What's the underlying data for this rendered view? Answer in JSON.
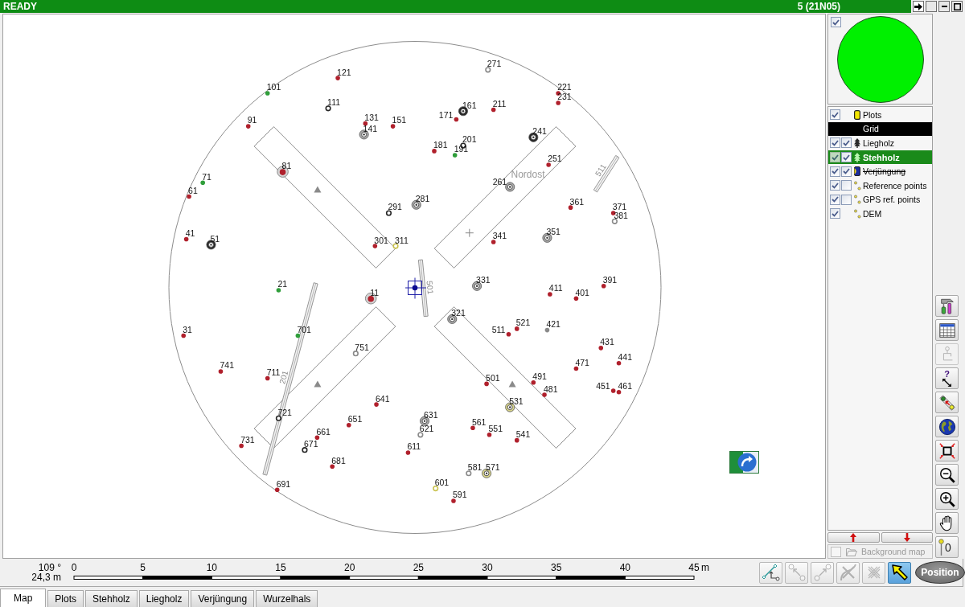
{
  "status_bar": {
    "state": "READY",
    "plot": "5 (21N05)"
  },
  "map": {
    "area_label": "Nordost",
    "logs": [
      {
        "label": "511"
      },
      {
        "label": "501"
      },
      {
        "label": "201"
      }
    ],
    "trees": [
      {
        "label": "271",
        "kind": "hollow",
        "color": "#8a8a8a"
      },
      {
        "label": "121",
        "kind": "dot",
        "color": "#b0202c"
      },
      {
        "label": "101",
        "kind": "dot",
        "color": "#2f9e3a"
      },
      {
        "label": "221",
        "kind": "dot",
        "color": "#b0202c"
      },
      {
        "label": "231",
        "kind": "dot",
        "color": "#b0202c"
      },
      {
        "label": "111",
        "kind": "hollow",
        "color": "#262626"
      },
      {
        "label": "161",
        "kind": "ring",
        "color": "#262626"
      },
      {
        "label": "171",
        "kind": "dot",
        "color": "#b0202c"
      },
      {
        "label": "211",
        "kind": "dot",
        "color": "#b0202c"
      },
      {
        "label": "91",
        "kind": "dot",
        "color": "#b0202c"
      },
      {
        "label": "131",
        "kind": "dot",
        "color": "#b0202c"
      },
      {
        "label": "141",
        "kind": "ring",
        "color": "#a8a8a8"
      },
      {
        "label": "151",
        "kind": "dot",
        "color": "#b0202c"
      },
      {
        "label": "241",
        "kind": "ring",
        "color": "#262626"
      },
      {
        "label": "181",
        "kind": "dot",
        "color": "#b0202c"
      },
      {
        "label": "201",
        "kind": "hollow",
        "color": "#262626"
      },
      {
        "label": "191",
        "kind": "dot",
        "color": "#2f9e3a"
      },
      {
        "label": "251",
        "kind": "dot",
        "color": "#b0202c"
      },
      {
        "label": "81",
        "kind": "target",
        "color": "#b0202c"
      },
      {
        "label": "71",
        "kind": "dot",
        "color": "#2f9e3a"
      },
      {
        "label": "61",
        "kind": "dot",
        "color": "#b0202c"
      },
      {
        "label": "261",
        "kind": "ring",
        "color": "#a8a8a8"
      },
      {
        "label": "281",
        "kind": "ring",
        "color": "#a8a8a8"
      },
      {
        "label": "291",
        "kind": "hollow",
        "color": "#262626"
      },
      {
        "label": "361",
        "kind": "dot",
        "color": "#b0202c"
      },
      {
        "label": "371",
        "kind": "dot",
        "color": "#b0202c"
      },
      {
        "label": "381",
        "kind": "hollow",
        "color": "#8a8a8a"
      },
      {
        "label": "41",
        "kind": "dot",
        "color": "#b0202c"
      },
      {
        "label": "51",
        "kind": "ring",
        "color": "#262626"
      },
      {
        "label": "301",
        "kind": "dot",
        "color": "#b0202c"
      },
      {
        "label": "311",
        "kind": "hollow",
        "color": "#c9c24e"
      },
      {
        "label": "341",
        "kind": "dot",
        "color": "#b0202c"
      },
      {
        "label": "351",
        "kind": "ring",
        "color": "#a8a8a8"
      },
      {
        "label": "331",
        "kind": "ring",
        "color": "#a8a8a8"
      },
      {
        "label": "21",
        "kind": "dot",
        "color": "#2f9e3a"
      },
      {
        "label": "11",
        "kind": "target",
        "color": "#b0202c"
      },
      {
        "label": "411",
        "kind": "dot",
        "color": "#b0202c"
      },
      {
        "label": "401",
        "kind": "dot",
        "color": "#b0202c"
      },
      {
        "label": "391",
        "kind": "dot",
        "color": "#b0202c"
      },
      {
        "label": "31",
        "kind": "dot",
        "color": "#b0202c"
      },
      {
        "label": "701",
        "kind": "dot",
        "color": "#2f9e3a"
      },
      {
        "label": "321",
        "kind": "ring",
        "color": "#a8a8a8"
      },
      {
        "label": "511",
        "kind": "dot",
        "color": "#b0202c"
      },
      {
        "label": "521",
        "kind": "dot",
        "color": "#b0202c"
      },
      {
        "label": "421",
        "kind": "dot",
        "color": "#8a8a8a"
      },
      {
        "label": "431",
        "kind": "dot",
        "color": "#b0202c"
      },
      {
        "label": "441",
        "kind": "dot",
        "color": "#b0202c"
      },
      {
        "label": "751",
        "kind": "hollow",
        "color": "#8a8a8a"
      },
      {
        "label": "741",
        "kind": "dot",
        "color": "#b0202c"
      },
      {
        "label": "711",
        "kind": "dot",
        "color": "#b0202c"
      },
      {
        "label": "471",
        "kind": "dot",
        "color": "#b0202c"
      },
      {
        "label": "451",
        "kind": "dot",
        "color": "#b0202c"
      },
      {
        "label": "461",
        "kind": "dot",
        "color": "#b0202c"
      },
      {
        "label": "501",
        "kind": "dot",
        "color": "#b0202c"
      },
      {
        "label": "491",
        "kind": "dot",
        "color": "#b0202c"
      },
      {
        "label": "481",
        "kind": "dot",
        "color": "#b0202c"
      },
      {
        "label": "641",
        "kind": "dot",
        "color": "#b0202c"
      },
      {
        "label": "531",
        "kind": "ring",
        "color": "#d8d48a"
      },
      {
        "label": "721",
        "kind": "hollow",
        "color": "#262626"
      },
      {
        "label": "651",
        "kind": "dot",
        "color": "#b0202c"
      },
      {
        "label": "631",
        "kind": "ring",
        "color": "#a8a8a8"
      },
      {
        "label": "621",
        "kind": "hollow",
        "color": "#8a8a8a"
      },
      {
        "label": "561",
        "kind": "dot",
        "color": "#b0202c"
      },
      {
        "label": "551",
        "kind": "dot",
        "color": "#b0202c"
      },
      {
        "label": "541",
        "kind": "dot",
        "color": "#b0202c"
      },
      {
        "label": "661",
        "kind": "dot",
        "color": "#b0202c"
      },
      {
        "label": "671",
        "kind": "hollow",
        "color": "#262626"
      },
      {
        "label": "731",
        "kind": "dot",
        "color": "#b0202c"
      },
      {
        "label": "611",
        "kind": "dot",
        "color": "#b0202c"
      },
      {
        "label": "681",
        "kind": "dot",
        "color": "#b0202c"
      },
      {
        "label": "581",
        "kind": "hollow",
        "color": "#8a8a8a"
      },
      {
        "label": "571",
        "kind": "ring",
        "color": "#d8d48a"
      },
      {
        "label": "601",
        "kind": "hollow",
        "color": "#c9c24e"
      },
      {
        "label": "691",
        "kind": "dot",
        "color": "#b0202c"
      },
      {
        "label": "591",
        "kind": "dot",
        "color": "#b0202c"
      }
    ]
  },
  "overview": {
    "visible": true
  },
  "layers": [
    {
      "label": "Plots",
      "checks": [
        {
          "checked": true,
          "disabled": false
        }
      ],
      "selected": false,
      "active": false,
      "struck": false
    },
    {
      "label": "Grid",
      "selected": true,
      "active": false,
      "struck": false
    },
    {
      "label": "Liegholz",
      "checks": [
        {
          "checked": true,
          "disabled": false
        },
        {
          "checked": true,
          "disabled": false
        }
      ],
      "selected": false,
      "active": false,
      "struck": false
    },
    {
      "label": "Stehholz",
      "checks": [
        {
          "checked": true,
          "disabled": true
        },
        {
          "checked": true,
          "disabled": false
        }
      ],
      "selected": false,
      "active": true,
      "struck": false
    },
    {
      "label": "Verjüngung",
      "checks": [
        {
          "checked": true,
          "disabled": false
        },
        {
          "checked": true,
          "disabled": false
        }
      ],
      "selected": false,
      "active": false,
      "struck": true
    },
    {
      "label": "Reference points",
      "checks": [
        {
          "checked": true,
          "disabled": false
        },
        {
          "checked": false,
          "disabled": false
        }
      ],
      "selected": false,
      "active": false,
      "struck": false
    },
    {
      "label": "GPS ref. points",
      "checks": [
        {
          "checked": true,
          "disabled": false
        },
        {
          "checked": false,
          "disabled": false
        }
      ],
      "selected": false,
      "active": false,
      "struck": false
    },
    {
      "label": "DEM",
      "checks": [
        {
          "checked": true,
          "disabled": false
        }
      ],
      "selected": false,
      "active": false,
      "struck": false
    }
  ],
  "background_map": {
    "label": "Background map",
    "checked": false,
    "disabled": true
  },
  "side_tools": [
    {
      "kind": "tools",
      "disabled": false
    },
    {
      "kind": "table",
      "disabled": false
    },
    {
      "kind": "diagram",
      "disabled": true
    },
    {
      "kind": "help",
      "label": "?",
      "disabled": false
    },
    {
      "kind": "measure",
      "disabled": false
    },
    {
      "kind": "globe",
      "disabled": false
    },
    {
      "kind": "extent",
      "disabled": false
    },
    {
      "kind": "zoom-out",
      "disabled": false
    },
    {
      "kind": "zoom-in",
      "disabled": false
    },
    {
      "kind": "hand",
      "disabled": false
    },
    {
      "kind": "pin",
      "label": "0",
      "disabled": false
    }
  ],
  "readout": {
    "bearing": "109 °",
    "distance": "24,3 m"
  },
  "scale": {
    "ticks": [
      "0",
      "5",
      "10",
      "15",
      "20",
      "25",
      "30",
      "35",
      "40",
      "45"
    ],
    "unit": "m"
  },
  "edit_tools": [
    {
      "kind": "polyline",
      "disabled": false,
      "selected": false
    },
    {
      "kind": "split",
      "disabled": true,
      "selected": false
    },
    {
      "kind": "join",
      "disabled": true,
      "selected": false
    },
    {
      "kind": "cut",
      "disabled": true,
      "selected": false
    },
    {
      "kind": "delete",
      "disabled": true,
      "selected": false
    },
    {
      "kind": "select",
      "disabled": false,
      "selected": true
    }
  ],
  "position_button": {
    "label": "Position"
  },
  "tabs": [
    {
      "label": "Map",
      "selected": true
    },
    {
      "label": "Plots",
      "selected": false
    },
    {
      "label": "Stehholz",
      "selected": false
    },
    {
      "label": "Liegholz",
      "selected": false
    },
    {
      "label": "Verjüngung",
      "selected": false
    },
    {
      "label": "Wurzelhals",
      "selected": false
    }
  ]
}
